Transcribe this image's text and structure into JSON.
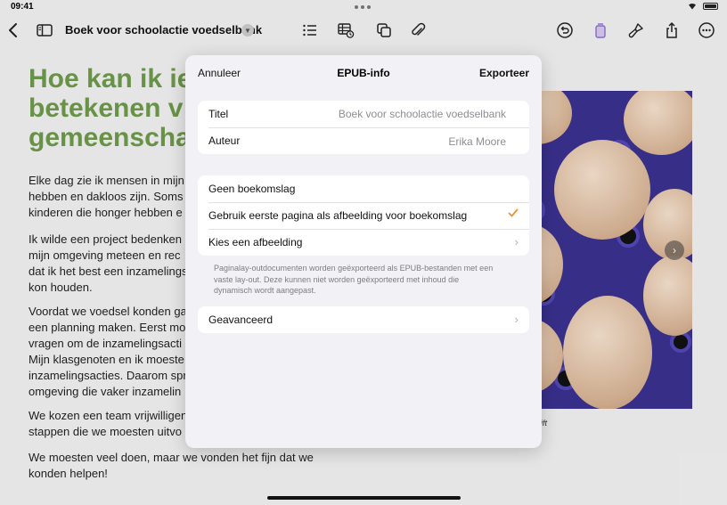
{
  "status_bar": {
    "time": "09:41"
  },
  "toolbar": {
    "document_title": "Boek voor schoolactie voedselbank"
  },
  "document": {
    "heading_lines": [
      "Hoe kan ik ie",
      "betekenen v",
      "gemeenscha"
    ],
    "paragraphs": [
      [
        "Elke dag zie ik mensen in mijn",
        "hebben en dakloos zijn. Soms",
        "kinderen die honger hebben e"
      ],
      [
        "Ik wilde een project bedenken",
        "mijn omgeving meteen en rec",
        "dat ik het best een inzamelings",
        "kon houden."
      ],
      [
        "Voordat we voedsel konden ga",
        "een planning maken. Eerst mo",
        "vragen om de inzamelingsacti",
        "Mijn klasgenoten en ik moeste",
        "inzamelingsacties. Daarom spr",
        "omgeving die vaker inzamelin"
      ],
      [
        "We kozen een team vrijwilligen",
        "stappen die we moesten uitvo"
      ],
      [
        "We moesten veel doen, maar we vonden het fijn dat we",
        "konden helpen!"
      ]
    ],
    "caption": "ift"
  },
  "modal": {
    "cancel": "Annuleer",
    "title": "EPUB-info",
    "export": "Exporteer",
    "fields": [
      {
        "label": "Titel",
        "placeholder": "Boek voor schoolactie voedselbank"
      },
      {
        "label": "Auteur",
        "placeholder": "Erika Moore"
      }
    ],
    "cover_options": [
      {
        "label": "Geen boekomslag"
      },
      {
        "label": "Gebruik eerste pagina als afbeelding voor boekomslag",
        "selected": true
      },
      {
        "label": "Kies een afbeelding"
      }
    ],
    "footnote_lines": [
      "Paginalay-outdocumenten worden geëxporteerd als EPUB-bestanden met een",
      "vaste lay-out. Deze kunnen niet worden geëxporteerd met inhoud die",
      "dynamisch wordt aangepast."
    ],
    "advanced": "Geavanceerd"
  },
  "colors": {
    "heading": "#6e9a4a",
    "accent": "#f0932b",
    "toolbar_icon": "#222222"
  },
  "icons": [
    "back-chevron-icon",
    "sidebar-icon",
    "list-icon",
    "table-icon",
    "shapes-icon",
    "paperclip-icon",
    "undo-icon",
    "page-icon",
    "paintbrush-icon",
    "share-icon",
    "more-icon"
  ]
}
